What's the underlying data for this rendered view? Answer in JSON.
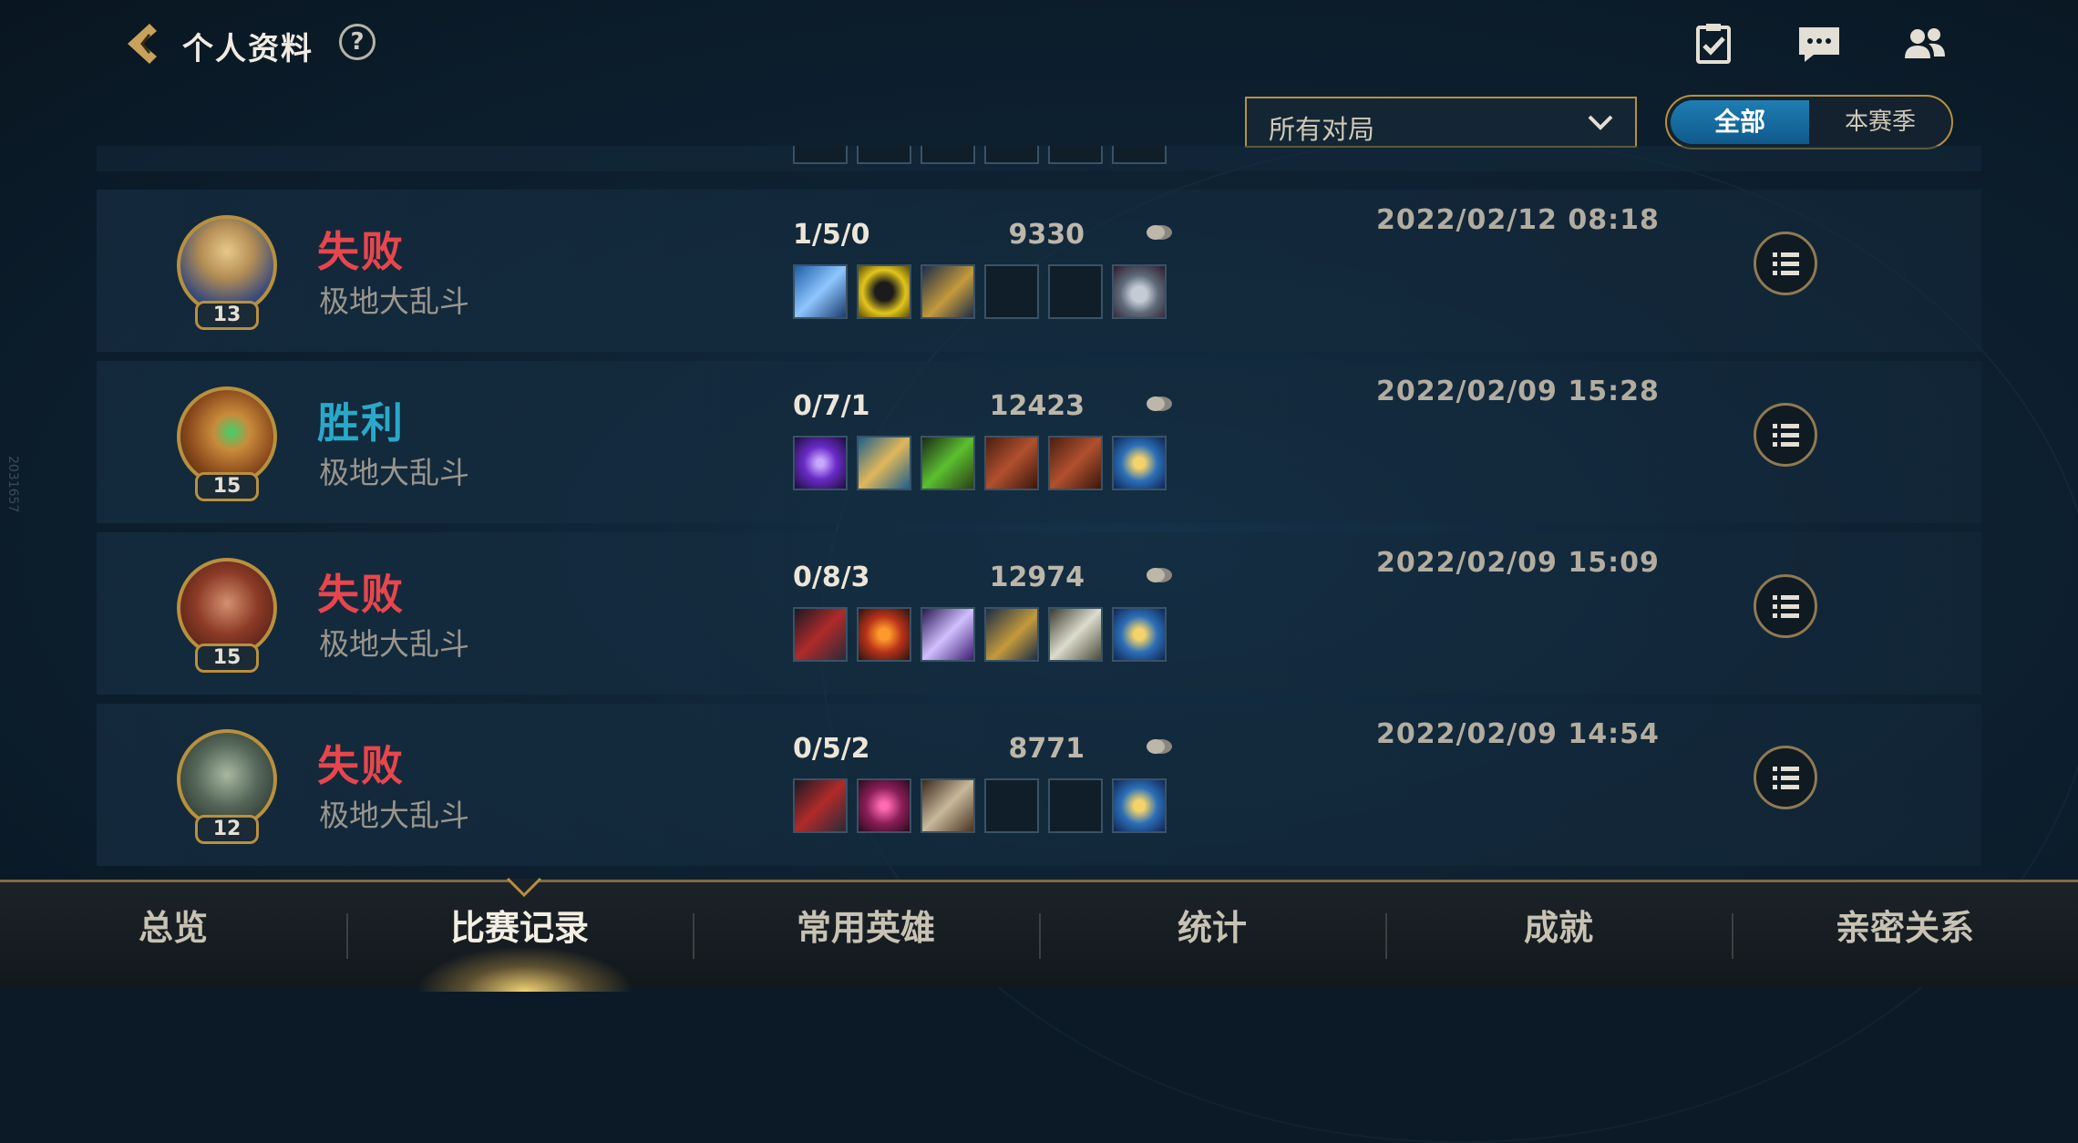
{
  "header": {
    "title": "个人资料",
    "help": "?"
  },
  "filter": {
    "selected": "所有对局"
  },
  "season_toggle": {
    "all": "全部",
    "season": "本赛季"
  },
  "matches": [
    {
      "result": "失败",
      "mode": "极地大乱斗",
      "level": "13",
      "kda": "1/5/0",
      "gold": "9330",
      "date": "2022/02/12 08:18"
    },
    {
      "result": "胜利",
      "mode": "极地大乱斗",
      "level": "15",
      "kda": "0/7/1",
      "gold": "12423",
      "date": "2022/02/09 15:28"
    },
    {
      "result": "失败",
      "mode": "极地大乱斗",
      "level": "15",
      "kda": "0/8/3",
      "gold": "12974",
      "date": "2022/02/09 15:09"
    },
    {
      "result": "失败",
      "mode": "极地大乱斗",
      "level": "12",
      "kda": "0/5/2",
      "gold": "8771",
      "date": "2022/02/09 14:54"
    }
  ],
  "nav": {
    "tabs": [
      "总览",
      "比赛记录",
      "常用英雄",
      "统计",
      "成就",
      "亲密关系"
    ]
  },
  "watermark": "2031657",
  "colors": {
    "accent": "#b8903e",
    "lose": "#e8464c",
    "win": "#28a9c9",
    "toggle_active": "#1f7db3"
  }
}
